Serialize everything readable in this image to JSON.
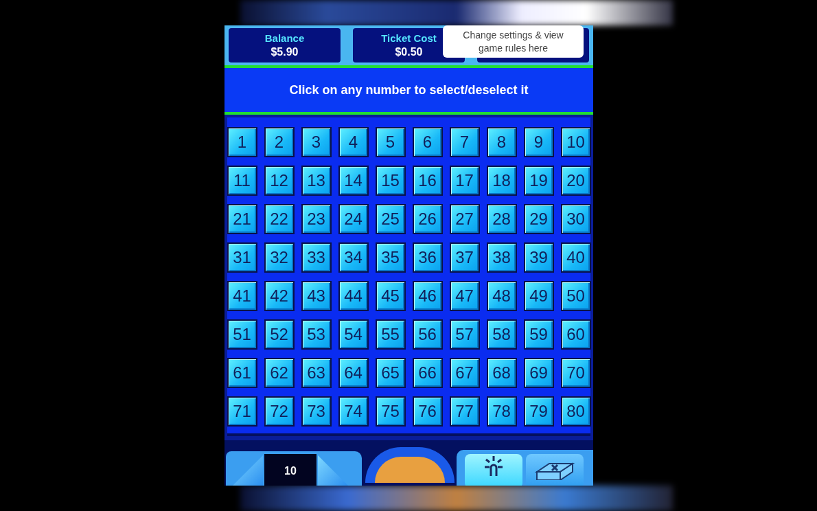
{
  "header": {
    "panels": [
      {
        "label": "Balance",
        "value": "$5.90"
      },
      {
        "label": "Ticket Cost",
        "value": "$0.50"
      }
    ],
    "tooltip": "Change settings & view game rules here"
  },
  "instruction": "Click on any number to select/deselect it",
  "numbers": [
    {
      "label": "1",
      "selected": false
    },
    {
      "label": "2",
      "selected": false
    },
    {
      "label": "3",
      "selected": false
    },
    {
      "label": "4",
      "selected": false
    },
    {
      "label": "5",
      "selected": false
    },
    {
      "label": "6",
      "selected": false
    },
    {
      "label": "7",
      "selected": false
    },
    {
      "label": "8",
      "selected": false
    },
    {
      "label": "9",
      "selected": false
    },
    {
      "label": "10",
      "selected": false
    },
    {
      "label": "11",
      "selected": false
    },
    {
      "label": "12",
      "selected": false
    },
    {
      "label": "13",
      "selected": false
    },
    {
      "label": "14",
      "selected": false
    },
    {
      "label": "15",
      "selected": false
    },
    {
      "label": "16",
      "selected": false
    },
    {
      "label": "17",
      "selected": false
    },
    {
      "label": "18",
      "selected": false
    },
    {
      "label": "19",
      "selected": false
    },
    {
      "label": "20",
      "selected": false
    },
    {
      "label": "21",
      "selected": false
    },
    {
      "label": "22",
      "selected": false
    },
    {
      "label": "23",
      "selected": false
    },
    {
      "label": "24",
      "selected": false
    },
    {
      "label": "25",
      "selected": false
    },
    {
      "label": "26",
      "selected": false
    },
    {
      "label": "27",
      "selected": false
    },
    {
      "label": "28",
      "selected": false
    },
    {
      "label": "29",
      "selected": false
    },
    {
      "label": "30",
      "selected": false
    },
    {
      "label": "31",
      "selected": false
    },
    {
      "label": "32",
      "selected": false
    },
    {
      "label": "33",
      "selected": false
    },
    {
      "label": "34",
      "selected": false
    },
    {
      "label": "35",
      "selected": false
    },
    {
      "label": "36",
      "selected": false
    },
    {
      "label": "37",
      "selected": false
    },
    {
      "label": "38",
      "selected": false
    },
    {
      "label": "39",
      "selected": false
    },
    {
      "label": "40",
      "selected": false
    },
    {
      "label": "41",
      "selected": false
    },
    {
      "label": "42",
      "selected": false
    },
    {
      "label": "43",
      "selected": false
    },
    {
      "label": "44",
      "selected": false
    },
    {
      "label": "45",
      "selected": false
    },
    {
      "label": "46",
      "selected": false
    },
    {
      "label": "47",
      "selected": false
    },
    {
      "label": "48",
      "selected": false
    },
    {
      "label": "49",
      "selected": false
    },
    {
      "label": "50",
      "selected": false
    },
    {
      "label": "51",
      "selected": false
    },
    {
      "label": "52",
      "selected": false
    },
    {
      "label": "53",
      "selected": false
    },
    {
      "label": "54",
      "selected": false
    },
    {
      "label": "55",
      "selected": false
    },
    {
      "label": "56",
      "selected": false
    },
    {
      "label": "57",
      "selected": false
    },
    {
      "label": "58",
      "selected": false
    },
    {
      "label": "59",
      "selected": false
    },
    {
      "label": "60",
      "selected": false
    },
    {
      "label": "61",
      "selected": false
    },
    {
      "label": "62",
      "selected": false
    },
    {
      "label": "63",
      "selected": false
    },
    {
      "label": "64",
      "selected": false
    },
    {
      "label": "65",
      "selected": false
    },
    {
      "label": "66",
      "selected": false
    },
    {
      "label": "67",
      "selected": false
    },
    {
      "label": "68",
      "selected": false
    },
    {
      "label": "69",
      "selected": false
    },
    {
      "label": "70",
      "selected": false
    },
    {
      "label": "71",
      "selected": false
    },
    {
      "label": "72",
      "selected": false
    },
    {
      "label": "73",
      "selected": false
    },
    {
      "label": "74",
      "selected": false
    },
    {
      "label": "75",
      "selected": false
    },
    {
      "label": "76",
      "selected": false
    },
    {
      "label": "77",
      "selected": false
    },
    {
      "label": "78",
      "selected": false
    },
    {
      "label": "79",
      "selected": false
    },
    {
      "label": "80",
      "selected": false
    }
  ],
  "controls": {
    "spots": "10"
  }
}
